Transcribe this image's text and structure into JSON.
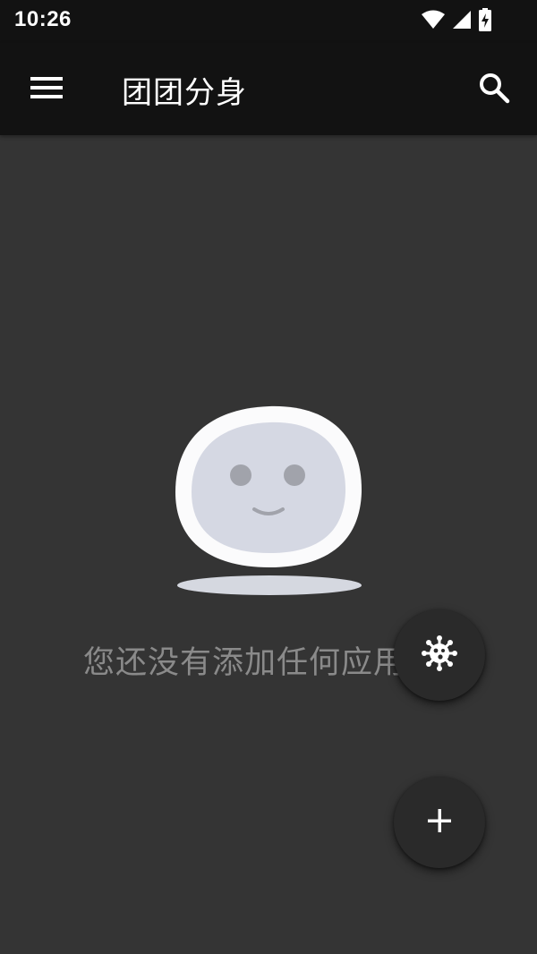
{
  "status_bar": {
    "time": "10:26",
    "icons": [
      "wifi-icon",
      "cellular-signal-icon",
      "battery-charging-icon"
    ]
  },
  "app_bar": {
    "title": "团团分身",
    "menu_icon": "hamburger-menu-icon",
    "search_icon": "search-icon"
  },
  "empty_state": {
    "message": "您还没有添加任何应用",
    "illustration": "smiling-face-illustration"
  },
  "fabs": [
    {
      "name": "virus-icon"
    },
    {
      "name": "plus-icon"
    }
  ],
  "colors": {
    "background": "#343434",
    "bars": "#121212",
    "text_primary": "#ffffff",
    "text_secondary": "#8a8a8a",
    "fab": "#2a2a2a"
  }
}
